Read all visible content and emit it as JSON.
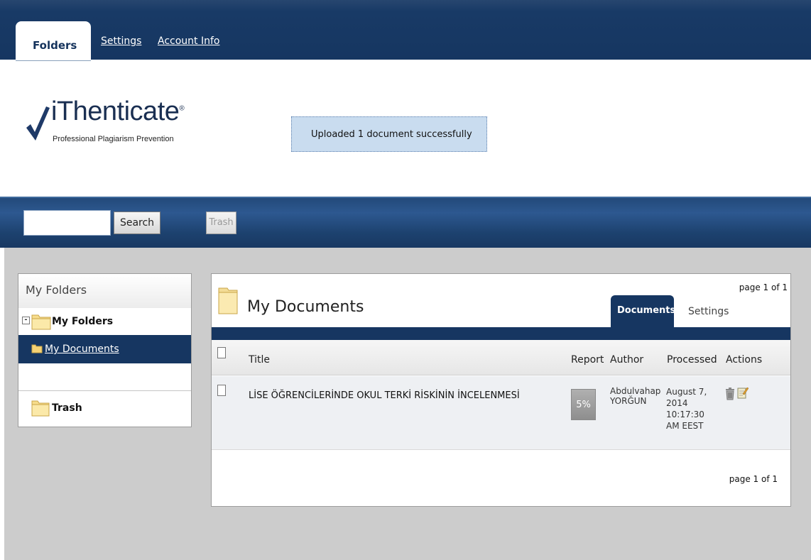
{
  "nav": {
    "tabs": [
      {
        "label": "Folders",
        "active": true
      },
      {
        "label": "Settings",
        "active": false
      },
      {
        "label": "Account Info",
        "active": false
      }
    ]
  },
  "logo": {
    "brand": "iThenticate",
    "registered": "®",
    "tagline": "Professional Plagiarism Prevention",
    "icon": "checkmark-icon"
  },
  "flash_message": "Uploaded 1 document successfully",
  "toolbar": {
    "search_placeholder": "",
    "search_value": "",
    "search_label": "Search",
    "trash_label": "Trash"
  },
  "sidebar": {
    "header": "My Folders",
    "root_label": "My Folders",
    "collapse_glyph": "-",
    "items": [
      {
        "label": "My Documents",
        "selected": true
      },
      {
        "label": "Trash",
        "selected": false
      }
    ]
  },
  "documents_panel": {
    "title": "My Documents",
    "page_top": "page 1 of 1",
    "page_bottom": "page 1 of 1",
    "tabs": [
      {
        "label": "Documents",
        "active": true
      },
      {
        "label": "Settings",
        "active": false
      }
    ],
    "columns": [
      "Title",
      "Report",
      "Author",
      "Processed",
      "Actions"
    ],
    "rows": [
      {
        "title": "LİSE ÖĞRENCİLERİNDE OKUL TERKİ RİSKİNİN İNCELENMESİ",
        "report": "5%",
        "author_first": "Abdulvahap",
        "author_last": "YORĞUN",
        "processed_date": "August 7,",
        "processed_year": "2014",
        "processed_time": "10:17:30",
        "processed_zone": "AM EEST",
        "actions": [
          "trash-icon",
          "edit-icon"
        ]
      }
    ]
  },
  "colors": {
    "navy": "#163661",
    "flash_bg": "#c9dcef",
    "content_bg": "#cccccc"
  }
}
